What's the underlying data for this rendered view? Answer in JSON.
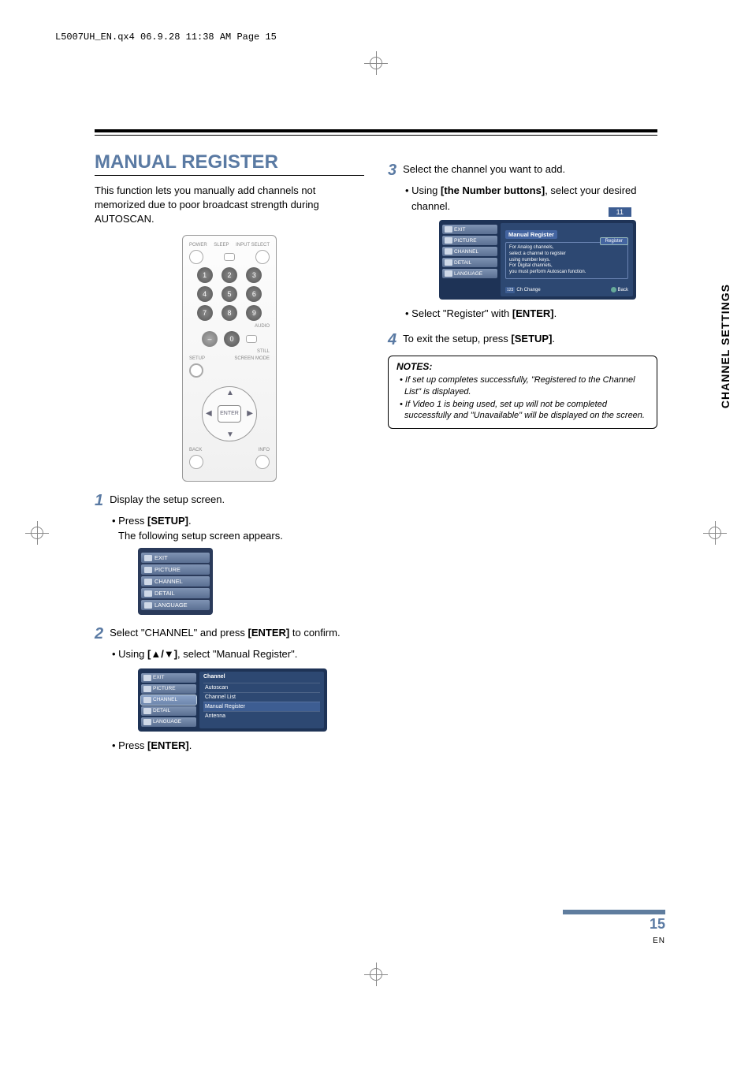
{
  "header": "L5007UH_EN.qx4  06.9.28  11:38 AM  Page 15",
  "side_tab": "CHANNEL SETTINGS",
  "page_number": "15",
  "page_lang": "EN",
  "section": {
    "title": "MANUAL REGISTER",
    "intro": "This function lets you manually add channels not memorized due to poor broadcast strength during AUTOSCAN."
  },
  "remote": {
    "labels": {
      "power": "POWER",
      "sleep": "SLEEP",
      "input": "INPUT SELECT",
      "audio": "AUDIO",
      "still": "STILL",
      "setup": "SETUP",
      "screen": "SCREEN MODE",
      "back": "BACK",
      "info": "INFO",
      "enter": "ENTER"
    },
    "numbers": [
      "1",
      "2",
      "3",
      "4",
      "5",
      "6",
      "7",
      "8",
      "9",
      "0"
    ]
  },
  "steps": {
    "s1": {
      "text": "Display the setup screen.",
      "b1a": "Press ",
      "b1b": "[SETUP]",
      "b1c": ".",
      "sub": "The following setup screen appears."
    },
    "s2": {
      "text_a": "Select \"CHANNEL\" and press ",
      "text_b": "[ENTER]",
      "text_c": " to confirm.",
      "b1a": "Using ",
      "b1b": "[▲/▼]",
      "b1c": ", select \"Manual Register\".",
      "b2a": "Press ",
      "b2b": "[ENTER]",
      "b2c": "."
    },
    "s3": {
      "text": "Select the channel you want to add.",
      "b1a": "Using ",
      "b1b": "[the Number buttons]",
      "b1c": ", select your desired channel.",
      "b2a": "Select \"Register\" with ",
      "b2b": "[ENTER]",
      "b2c": "."
    },
    "s4": {
      "text_a": "To exit the setup, press ",
      "text_b": "[SETUP]",
      "text_c": "."
    }
  },
  "osd": {
    "menu_items": {
      "exit": "EXIT",
      "picture": "PICTURE",
      "channel": "CHANNEL",
      "detail": "DETAIL",
      "language": "LANGUAGE"
    },
    "channel_panel": {
      "header": "Channel",
      "rows": {
        "autoscan": "Autoscan",
        "channel_list": "Channel List",
        "manual_register": "Manual Register",
        "antenna": "Antenna"
      }
    },
    "manreg_panel": {
      "badge": "11",
      "header": "Manual Register",
      "msg_l1": "For Analog channels,",
      "msg_l2": "select a channel to register",
      "msg_l3": "using number keys.",
      "msg_l4": "For Digital channels,",
      "msg_l5": "you must perform Autoscan function.",
      "register_btn": "Register",
      "footer_change": "Ch Change",
      "footer_back": "Back"
    }
  },
  "notes": {
    "title": "NOTES:",
    "n1": "If set up completes successfully, \"Registered to the Channel List\" is displayed.",
    "n2": "If Video 1 is being used, set up will not be completed successfully and \"Unavailable\" will be displayed on the screen."
  }
}
